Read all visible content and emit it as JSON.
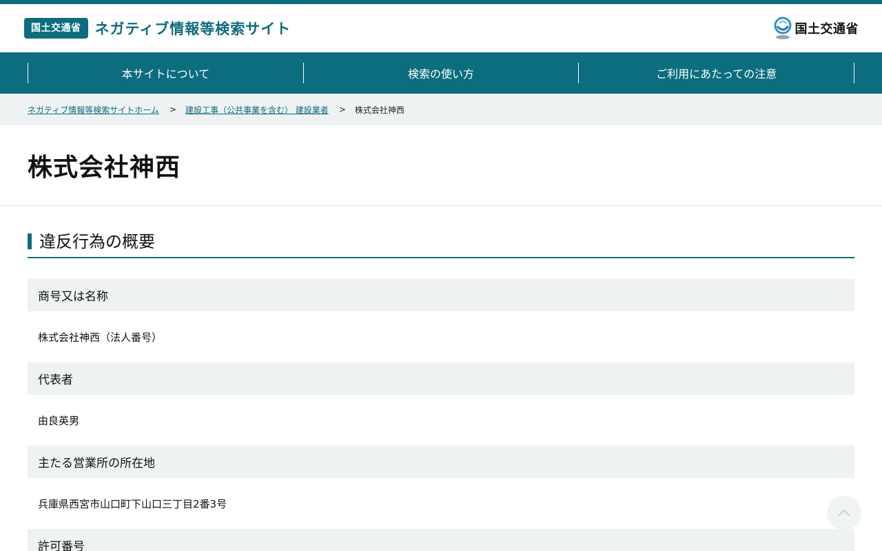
{
  "header": {
    "ministry_badge": "国土交通省",
    "site_title": "ネガティブ情報等検索サイト",
    "ministry_logo_text": "国土交通省",
    "ministry_logo_icon": "mlit-emblem-icon"
  },
  "nav": {
    "items": [
      {
        "label": "本サイトについて"
      },
      {
        "label": "検索の使い方"
      },
      {
        "label": "ご利用にあたっての注意"
      }
    ]
  },
  "breadcrumb": {
    "home": "ネガティブ情報等検索サイトホーム",
    "category": "建設工事（公共事業を含む） 建設業者",
    "current": "株式会社神西",
    "separator": ">"
  },
  "page": {
    "title": "株式会社神西"
  },
  "section": {
    "heading": "違反行為の概要",
    "items": [
      {
        "label": "商号又は名称",
        "value": "株式会社神西（法人番号）"
      },
      {
        "label": "代表者",
        "value": "由良英男"
      },
      {
        "label": "主たる営業所の所在地",
        "value": "兵庫県西宮市山口町下山口三丁目2番3号"
      },
      {
        "label": "許可番号",
        "value": ""
      }
    ]
  },
  "colors": {
    "brand": "#0b6d7e",
    "light_bg": "#eef2f3"
  },
  "pagetop_icon": "chevron-up-icon"
}
